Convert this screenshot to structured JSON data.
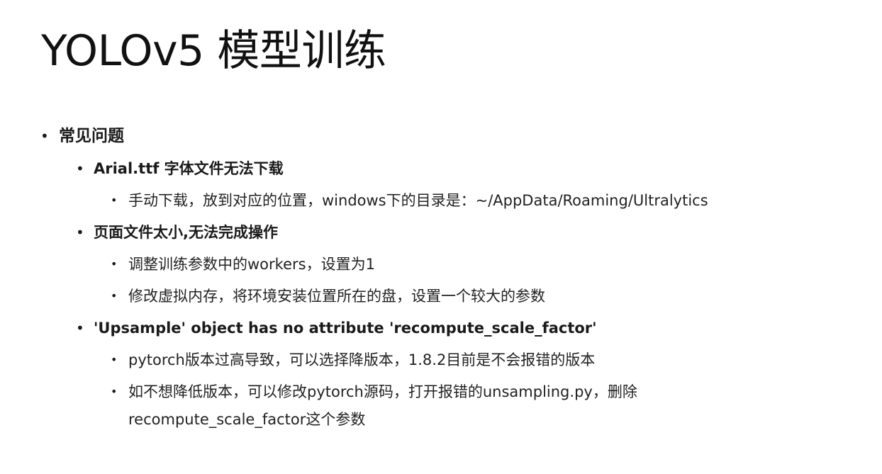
{
  "title": "YOLOv5 模型训练",
  "bullet_symbol": "•",
  "section": {
    "heading": "常见问题",
    "issues": [
      {
        "title": "Arial.ttf 字体文件无法下载",
        "solutions": [
          "手动下载，放到对应的位置，windows下的目录是：~/AppData/Roaming/Ultralytics"
        ]
      },
      {
        "title": "页面文件太小,无法完成操作",
        "solutions": [
          "调整训练参数中的workers，设置为1",
          "修改虚拟内存，将环境安装位置所在的盘，设置一个较大的参数"
        ]
      },
      {
        "title": "'Upsample' object has no attribute 'recompute_scale_factor'",
        "solutions": [
          "pytorch版本过高导致，可以选择降版本，1.8.2目前是不会报错的版本",
          "如不想降低版本，可以修改pytorch源码，打开报错的unsampling.py，删除"
        ],
        "continuation": "recompute_scale_factor这个参数"
      }
    ]
  }
}
